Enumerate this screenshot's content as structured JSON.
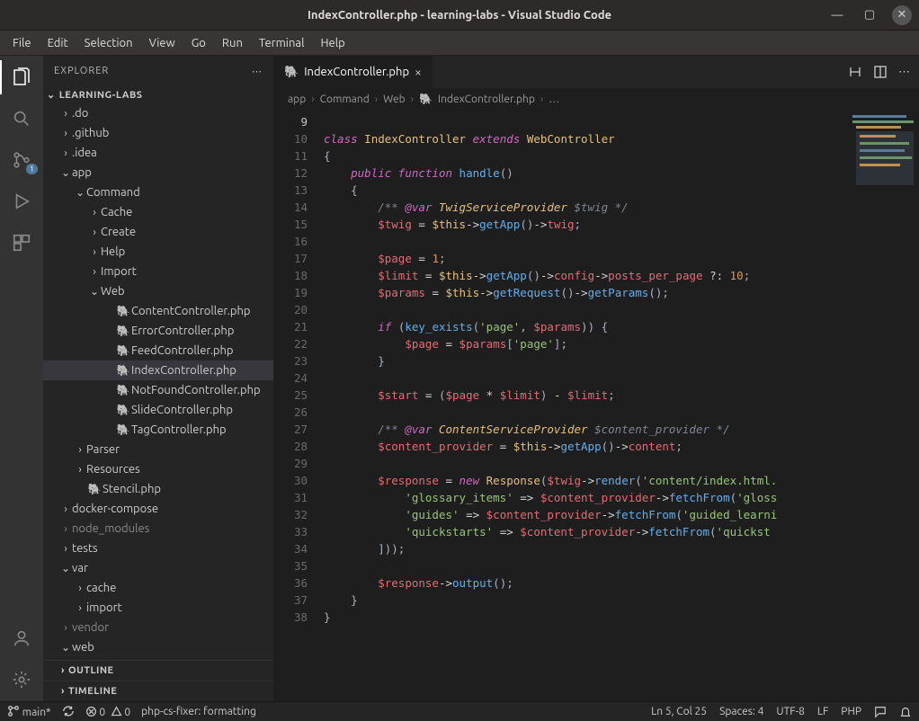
{
  "window": {
    "title": "IndexController.php - learning-labs - Visual Studio Code"
  },
  "menu": [
    "File",
    "Edit",
    "Selection",
    "View",
    "Go",
    "Run",
    "Terminal",
    "Help"
  ],
  "sidebar": {
    "title": "EXPLORER",
    "root": "LEARNING-LABS",
    "outline": "OUTLINE",
    "timeline": "TIMELINE",
    "tree": [
      {
        "indent": 1,
        "chev": "›",
        "label": ".do"
      },
      {
        "indent": 1,
        "chev": "›",
        "label": ".github"
      },
      {
        "indent": 1,
        "chev": "›",
        "label": ".idea"
      },
      {
        "indent": 1,
        "chev": "⌄",
        "label": "app"
      },
      {
        "indent": 2,
        "chev": "⌄",
        "label": "Command"
      },
      {
        "indent": 3,
        "chev": "›",
        "label": "Cache"
      },
      {
        "indent": 3,
        "chev": "›",
        "label": "Create"
      },
      {
        "indent": 3,
        "chev": "›",
        "label": "Help"
      },
      {
        "indent": 3,
        "chev": "›",
        "label": "Import"
      },
      {
        "indent": 3,
        "chev": "⌄",
        "label": "Web"
      },
      {
        "indent": 4,
        "chev": "",
        "icon": "php",
        "label": "ContentController.php"
      },
      {
        "indent": 4,
        "chev": "",
        "icon": "php",
        "label": "ErrorController.php"
      },
      {
        "indent": 4,
        "chev": "",
        "icon": "php",
        "label": "FeedController.php"
      },
      {
        "indent": 4,
        "chev": "",
        "icon": "php",
        "label": "IndexController.php",
        "active": true
      },
      {
        "indent": 4,
        "chev": "",
        "icon": "php",
        "label": "NotFoundController.php"
      },
      {
        "indent": 4,
        "chev": "",
        "icon": "php",
        "label": "SlideController.php"
      },
      {
        "indent": 4,
        "chev": "",
        "icon": "php",
        "label": "TagController.php"
      },
      {
        "indent": 2,
        "chev": "›",
        "label": "Parser"
      },
      {
        "indent": 2,
        "chev": "›",
        "label": "Resources"
      },
      {
        "indent": 2,
        "chev": "",
        "icon": "php",
        "label": "Stencil.php"
      },
      {
        "indent": 1,
        "chev": "›",
        "label": "docker-compose"
      },
      {
        "indent": 1,
        "chev": "›",
        "label": "node_modules",
        "dim": true
      },
      {
        "indent": 1,
        "chev": "›",
        "label": "tests"
      },
      {
        "indent": 1,
        "chev": "⌄",
        "label": "var"
      },
      {
        "indent": 2,
        "chev": "›",
        "label": "cache"
      },
      {
        "indent": 2,
        "chev": "›",
        "label": "import"
      },
      {
        "indent": 1,
        "chev": "›",
        "label": "vendor",
        "dim": true
      },
      {
        "indent": 1,
        "chev": "⌄",
        "label": "web"
      }
    ]
  },
  "tab": {
    "label": "IndexController.php"
  },
  "breadcrumb": [
    "app",
    "Command",
    "Web",
    "IndexController.php",
    "…"
  ],
  "code": {
    "start": 9,
    "lines": [
      "",
      "<kw>class</kw> <cls>IndexController</cls> <kw>extends</kw> <cls>WebController</cls>",
      "<pn>{</pn>",
      "    <kw>public</kw> <kw>function</kw> <fn>handle</fn><pn>()</pn>",
      "    <pn>{</pn>",
      "        <cmt>/** </cmt><doc>@var</doc> <dtc>TwigServiceProvider</dtc> <cmt>$twig */</cmt>",
      "        <var>$twig</var> <op>=</op> <this>$this</this><op>-></op><fn>getApp</fn><pn>()</pn><op>-></op><prop>twig</prop><pn>;</pn>",
      "",
      "        <var>$page</var> <op>=</op> <num>1</num><pn>;</pn>",
      "        <var>$limit</var> <op>=</op> <this>$this</this><op>-></op><fn>getApp</fn><pn>()</pn><op>-></op><prop>config</prop><op>-></op><prop>posts_per_page</prop> <op>?:</op> <num>10</num><pn>;</pn>",
      "        <var>$params</var> <op>=</op> <this>$this</this><op>-></op><fn>getRequest</fn><pn>()</pn><op>-></op><fn>getParams</fn><pn>();</pn>",
      "",
      "        <kw>if</kw> <pn>(</pn><fn>key_exists</fn><pn>(</pn><str>'page'</str><pn>,</pn> <var>$params</var><pn>))</pn> <pn>{</pn>",
      "            <var>$page</var> <op>=</op> <var>$params</var><pn>[</pn><str>'page'</str><pn>];</pn>",
      "        <pn>}</pn>",
      "",
      "        <var>$start</var> <op>=</op> <pn>(</pn><var>$page</var> <op>*</op> <var>$limit</var><pn>)</pn> <op>-</op> <var>$limit</var><pn>;</pn>",
      "",
      "        <cmt>/** </cmt><doc>@var</doc> <dtc>ContentServiceProvider</dtc> <cmt>$content_provider */</cmt>",
      "        <var>$content_provider</var> <op>=</op> <this>$this</this><op>-></op><fn>getApp</fn><pn>()</pn><op>-></op><prop>content</prop><pn>;</pn>",
      "",
      "        <var>$response</var> <op>=</op> <kw>new</kw> <cls>Response</cls><pn>(</pn><var>$twig</var><op>-></op><fn>render</fn><pn>(</pn><str>'content/index.html.</str>",
      "            <str>'glossary_items'</str> <op>=></op> <var>$content_provider</var><op>-></op><fn>fetchFrom</fn><pn>(</pn><str>'gloss</str>",
      "            <str>'guides'</str> <op>=></op> <var>$content_provider</var><op>-></op><fn>fetchFrom</fn><pn>(</pn><str>'guided_learni</str>",
      "            <str>'quickstarts'</str> <op>=></op> <var>$content_provider</var><op>-></op><fn>fetchFrom</fn><pn>(</pn><str>'quickst</str>",
      "        <pn>]));</pn>",
      "",
      "        <var>$response</var><op>-></op><fn>output</fn><pn>();</pn>",
      "    <pn>}</pn>",
      "<pn>}</pn>"
    ]
  },
  "status": {
    "branch": "main*",
    "errors": "0",
    "warnings": "0",
    "formatter": "php-cs-fixer: formatting",
    "pos": "Ln 5, Col 25",
    "spaces": "Spaces: 4",
    "encoding": "UTF-8",
    "eol": "LF",
    "lang": "PHP"
  },
  "scm_badge": "1"
}
